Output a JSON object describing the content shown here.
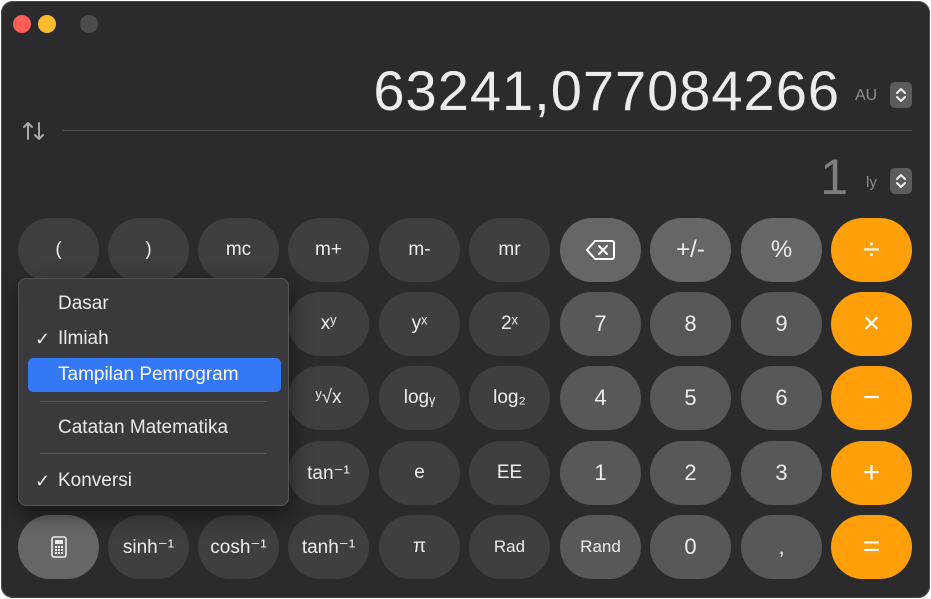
{
  "display": {
    "primary_value": "63241,077084266",
    "primary_unit": "AU",
    "secondary_value": "1",
    "secondary_unit": "ly"
  },
  "keys": {
    "row1": [
      "(",
      ")",
      "mc",
      "m+",
      "m-",
      "mr",
      "⌫",
      "+/-",
      "%",
      "÷"
    ],
    "row2": [
      "xʸ",
      "yˣ",
      "2ˣ",
      "7",
      "8",
      "9",
      "×"
    ],
    "row3": [
      "ʸ√x",
      "logᵧ",
      "log₂",
      "4",
      "5",
      "6",
      "−"
    ],
    "row4": [
      "tan⁻¹",
      "e",
      "EE",
      "1",
      "2",
      "3",
      "+"
    ],
    "row5": [
      "sinh⁻¹",
      "cosh⁻¹",
      "tanh⁻¹",
      "π",
      "Rad",
      "Rand",
      "0",
      ",",
      "="
    ]
  },
  "menu": {
    "items": [
      {
        "label": "Dasar",
        "checked": false,
        "highlighted": false
      },
      {
        "label": "Ilmiah",
        "checked": true,
        "highlighted": false
      },
      {
        "label": "Tampilan Pemrogram",
        "checked": false,
        "highlighted": true
      },
      {
        "label": "Catatan Matematika",
        "checked": false,
        "highlighted": false
      },
      {
        "label": "Konversi",
        "checked": true,
        "highlighted": false
      }
    ],
    "check_glyph": "✓"
  },
  "colors": {
    "window_bg": "#2b2b2d",
    "operator_orange": "#ff9f0a",
    "menu_highlight": "#3478f6"
  }
}
